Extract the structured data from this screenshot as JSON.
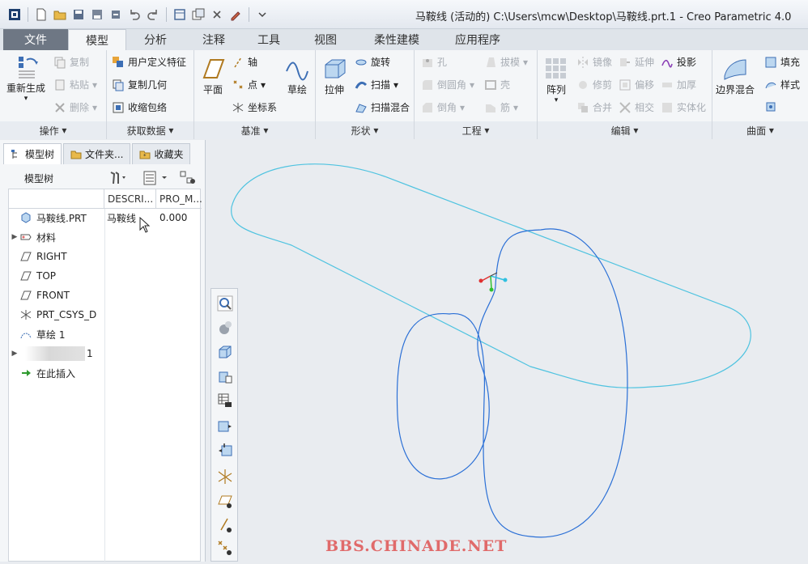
{
  "window": {
    "title": "马鞍线 (活动的) C:\\Users\\mcw\\Desktop\\马鞍线.prt.1 - Creo Parametric 4.0"
  },
  "quick_access": [
    "app-icon",
    "new-icon",
    "open-icon",
    "save-icon",
    "save-as-icon",
    "regenerate-icon",
    "undo-icon",
    "redo-icon",
    "window-icon",
    "switch-window-icon",
    "close-icon",
    "customize-icon"
  ],
  "tabs": [
    {
      "label": "文件"
    },
    {
      "label": "模型"
    },
    {
      "label": "分析"
    },
    {
      "label": "注释"
    },
    {
      "label": "工具"
    },
    {
      "label": "视图"
    },
    {
      "label": "柔性建模"
    },
    {
      "label": "应用程序"
    }
  ],
  "ribbon": {
    "ops": {
      "title": "操作",
      "regen": "重新生成",
      "copy": "复制",
      "paste": "粘贴",
      "delete": "删除"
    },
    "getdata": {
      "title": "获取数据",
      "udf": "用户定义特征",
      "copygeom": "复制几何",
      "shrinkwrap": "收缩包络"
    },
    "datum": {
      "title": "基准",
      "plane": "平面",
      "axis": "轴",
      "point": "点",
      "csys": "坐标系",
      "sketch": "草绘"
    },
    "shape": {
      "title": "形状",
      "extrude": "拉伸",
      "revolve": "旋转",
      "sweep": "扫描",
      "swept_blend": "扫描混合"
    },
    "eng": {
      "title": "工程",
      "hole": "孔",
      "round": "倒圆角",
      "chamfer": "倒角",
      "draft": "拔模",
      "shell": "壳",
      "rib": "筋"
    },
    "edit": {
      "title": "编辑",
      "pattern": "阵列",
      "mirror": "镜像",
      "trim": "修剪",
      "merge": "合并",
      "extend": "延伸",
      "offset": "偏移",
      "intersect": "相交",
      "project": "投影",
      "thicken": "加厚",
      "solidify": "实体化"
    },
    "surfaces": {
      "title": "曲面",
      "boundary_blend": "边界混合",
      "fill": "填充",
      "style": "样式"
    }
  },
  "panel": {
    "tabs": [
      "模型树",
      "文件夹...",
      "收藏夹"
    ],
    "tree_label": "模型树",
    "columns": [
      "DESCRI...",
      "PRO_M..."
    ],
    "rows": [
      {
        "label": "马鞍线.PRT",
        "desc": "马鞍线",
        "val": "0.000",
        "icon": "part-icon"
      },
      {
        "label": "材料",
        "icon": "material-icon",
        "expandable": true
      },
      {
        "label": "RIGHT",
        "icon": "plane-icon"
      },
      {
        "label": "TOP",
        "icon": "plane-icon"
      },
      {
        "label": "FRONT",
        "icon": "plane-icon"
      },
      {
        "label": "PRT_CSYS_D",
        "icon": "csys-icon"
      },
      {
        "label": "草绘 1",
        "icon": "sketch-icon"
      },
      {
        "label": "1",
        "icon": "blurred-feature-icon",
        "expandable": true
      },
      {
        "label": "在此插入",
        "icon": "insert-arrow-icon"
      }
    ]
  },
  "watermark": "BBS.CHINADE.NET",
  "colors": {
    "curve_cyan": "#4fc3e0",
    "curve_blue": "#2a6fd6",
    "accent": "#3d6fb5"
  }
}
